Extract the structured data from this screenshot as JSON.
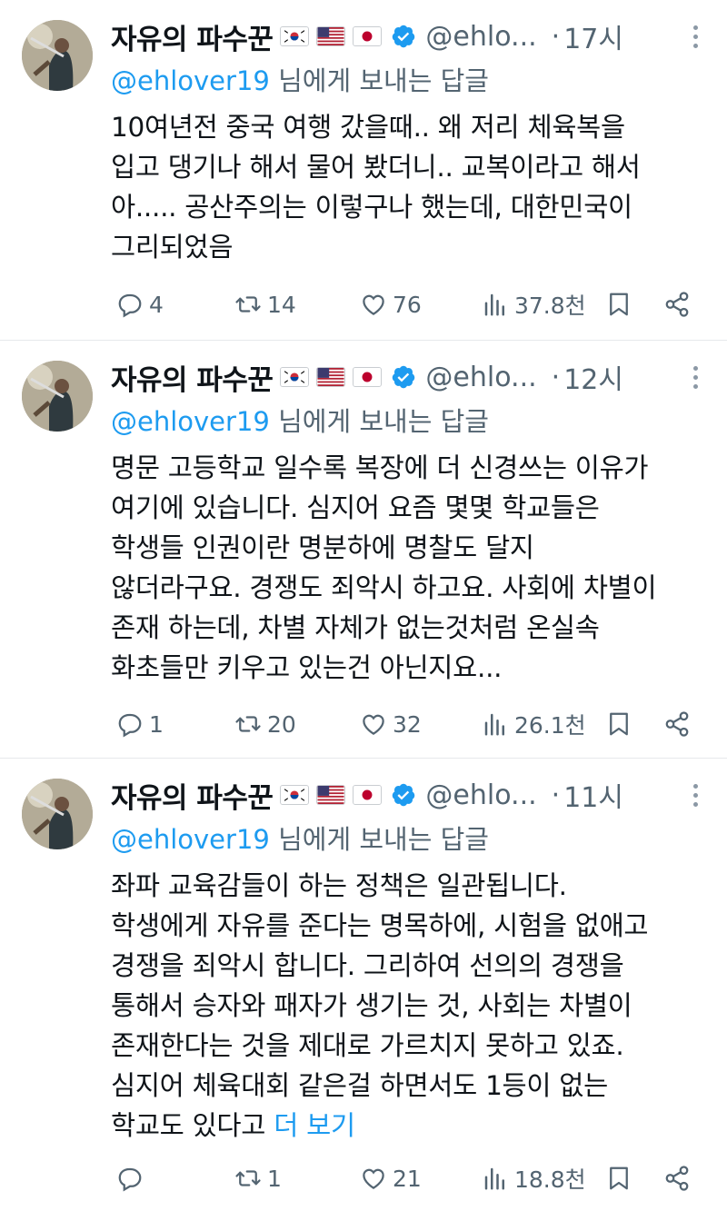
{
  "tweets": [
    {
      "author_name": "자유의 파수꾼",
      "handle": "@ehlo...",
      "dot": "·",
      "time": "17시",
      "reply_prefix": "@ehlover19",
      "reply_suffix": " 님에게 보내는 답글",
      "lines": [
        "10여년전 중국 여행 갔을때.. 왜 저리 체육복을",
        "입고 댕기나 해서 물어 봤더니.. 교복이라고 해서",
        "아..... 공산주의는 이렇구나 했는데,  대한민국이",
        "그리되었음"
      ],
      "show_more": "",
      "stats": {
        "replies": "4",
        "retweets": "14",
        "likes": "76",
        "views": "37.8천"
      }
    },
    {
      "author_name": "자유의 파수꾼",
      "handle": "@ehlo...",
      "dot": "·",
      "time": "12시",
      "reply_prefix": "@ehlover19",
      "reply_suffix": " 님에게 보내는 답글",
      "lines": [
        "명문 고등학교 일수록 복장에 더 신경쓰는 이유가",
        "여기에 있습니다. 심지어 요즘 몇몇 학교들은",
        "학생들 인권이란 명분하에 명찰도 달지",
        "않더라구요. 경쟁도 죄악시 하고요. 사회에 차별이",
        "존재 하는데, 차별 자체가 없는것처럼 온실속",
        "화초들만 키우고 있는건 아닌지요..."
      ],
      "show_more": "",
      "stats": {
        "replies": "1",
        "retweets": "20",
        "likes": "32",
        "views": "26.1천"
      }
    },
    {
      "author_name": "자유의 파수꾼",
      "handle": "@ehlo...",
      "dot": "·",
      "time": "11시",
      "reply_prefix": "@ehlover19",
      "reply_suffix": " 님에게 보내는 답글",
      "lines": [
        "좌파 교육감들이 하는 정책은 일관됩니다.",
        "학생에게 자유를 준다는 명목하에, 시험을 없애고",
        "경쟁을 죄악시 합니다. 그리하여 선의의 경쟁을",
        "통해서 승자와 패자가 생기는 것, 사회는 차별이",
        "존재한다는 것을 제대로 가르치지 못하고 있죠.",
        "심지어 체육대회 같은걸 하면서도 1등이 없는",
        "학교도 있다고 "
      ],
      "show_more": "더 보기",
      "stats": {
        "replies": "",
        "retweets": "1",
        "likes": "21",
        "views": "18.8천"
      }
    }
  ],
  "icons": [
    "reply-icon",
    "retweet-icon",
    "like-icon",
    "views-icon",
    "bookmark-icon",
    "share-icon",
    "more-icon",
    "verified-icon"
  ],
  "colors": {
    "accent": "#1d9bf0",
    "secondary_text": "#536471",
    "text": "#0f1419"
  }
}
